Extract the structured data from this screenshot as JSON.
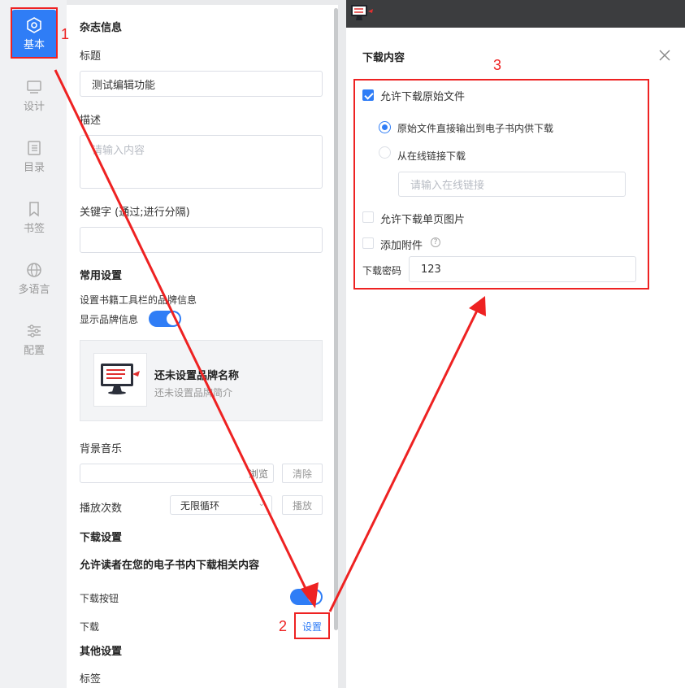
{
  "sidebar": {
    "items": [
      {
        "label": "基本",
        "icon": "hexagon-gear-icon",
        "active": true
      },
      {
        "label": "设计",
        "icon": "monitor-icon"
      },
      {
        "label": "目录",
        "icon": "document-list-icon"
      },
      {
        "label": "书签",
        "icon": "bookmark-icon"
      },
      {
        "label": "多语言",
        "icon": "globe-icon"
      },
      {
        "label": "配置",
        "icon": "sliders-icon"
      }
    ]
  },
  "panel": {
    "magazine_section": "杂志信息",
    "title_label": "标题",
    "title_value": "测试编辑功能",
    "desc_label": "描述",
    "desc_placeholder": "请输入内容",
    "keywords_label": "关键字 (通过;进行分隔)",
    "common_section": "常用设置",
    "brand_info_desc": "设置书籍工具栏的品牌信息",
    "show_brand_label": "显示品牌信息",
    "brand_name": "还未设置品牌名称",
    "brand_intro": "还未设置品牌简介",
    "bg_music_label": "背景音乐",
    "browse_label": "浏览",
    "clear_label": "清除",
    "play_count_label": "播放次数",
    "play_mode_value": "无限循环",
    "play_label": "播放",
    "download_section": "下载设置",
    "download_desc": "允许读者在您的电子书内下载相关内容",
    "download_button_label": "下载按钮",
    "download_label": "下载",
    "settings_link": "设置",
    "other_section": "其他设置",
    "tags_label": "标签"
  },
  "dialog": {
    "title": "下载内容",
    "allow_original": "允许下载原始文件",
    "radio_direct": "原始文件直接输出到电子书内供下载",
    "radio_online": "从在线链接下载",
    "online_link_placeholder": "请输入在线链接",
    "allow_single_page": "允许下载单页图片",
    "add_attachment": "添加附件",
    "password_label": "下载密码",
    "password_value": "123"
  },
  "annotations": {
    "n1": "1",
    "n2": "2",
    "n3": "3"
  },
  "colors": {
    "accent": "#2f7df6",
    "annotation_red": "#ee2222"
  }
}
